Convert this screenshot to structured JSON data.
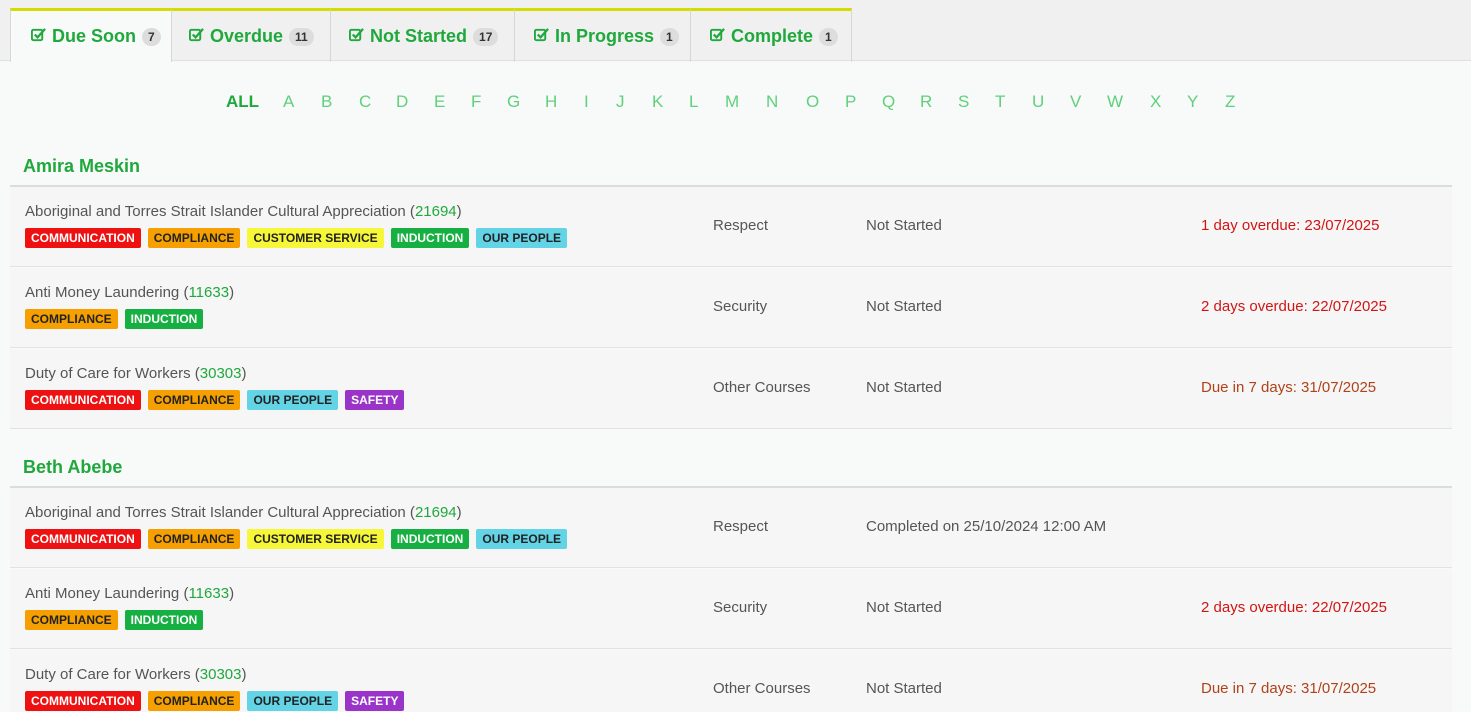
{
  "tabs": [
    {
      "label": "Due Soon",
      "count": "7"
    },
    {
      "label": "Overdue",
      "count": "11"
    },
    {
      "label": "Not Started",
      "count": "17"
    },
    {
      "label": "In Progress",
      "count": "1"
    },
    {
      "label": "Complete",
      "count": "1"
    }
  ],
  "alphabet": [
    "ALL",
    "A",
    "B",
    "C",
    "D",
    "E",
    "F",
    "G",
    "H",
    "I",
    "J",
    "K",
    "L",
    "M",
    "N",
    "O",
    "P",
    "Q",
    "R",
    "S",
    "T",
    "U",
    "V",
    "W",
    "X",
    "Y",
    "Z"
  ],
  "people": [
    {
      "name": "Amira Meskin",
      "courses": [
        {
          "title": "Aboriginal and Torres Strait Islander Cultural Appreciation",
          "code": "21694",
          "tags": [
            "COMMUNICATION",
            "COMPLIANCE",
            "CUSTOMER SERVICE",
            "INDUCTION",
            "OUR PEOPLE"
          ],
          "category": "Respect",
          "status": "Not Started",
          "due": "1 day overdue: 23/07/2025",
          "due_type": "overdue"
        },
        {
          "title": "Anti Money Laundering",
          "code": "11633",
          "tags": [
            "COMPLIANCE",
            "INDUCTION"
          ],
          "category": "Security",
          "status": "Not Started",
          "due": "2 days overdue: 22/07/2025",
          "due_type": "overdue"
        },
        {
          "title": "Duty of Care for Workers",
          "code": "30303",
          "tags": [
            "COMMUNICATION",
            "COMPLIANCE",
            "OUR PEOPLE",
            "SAFETY"
          ],
          "category": "Other Courses",
          "status": "Not Started",
          "due": "Due in 7 days: 31/07/2025",
          "due_type": "soon"
        }
      ]
    },
    {
      "name": "Beth Abebe",
      "courses": [
        {
          "title": "Aboriginal and Torres Strait Islander Cultural Appreciation",
          "code": "21694",
          "tags": [
            "COMMUNICATION",
            "COMPLIANCE",
            "CUSTOMER SERVICE",
            "INDUCTION",
            "OUR PEOPLE"
          ],
          "category": "Respect",
          "status": "Completed on 25/10/2024 12:00 AM",
          "due": "",
          "due_type": "none"
        },
        {
          "title": "Anti Money Laundering",
          "code": "11633",
          "tags": [
            "COMPLIANCE",
            "INDUCTION"
          ],
          "category": "Security",
          "status": "Not Started",
          "due": "2 days overdue: 22/07/2025",
          "due_type": "overdue"
        },
        {
          "title": "Duty of Care for Workers",
          "code": "30303",
          "tags": [
            "COMMUNICATION",
            "COMPLIANCE",
            "OUR PEOPLE",
            "SAFETY"
          ],
          "category": "Other Courses",
          "status": "Not Started",
          "due": "Due in 7 days: 31/07/2025",
          "due_type": "soon"
        }
      ]
    }
  ],
  "tag_colors": {
    "COMMUNICATION": "#ee1111",
    "COMPLIANCE": "#f5a000",
    "CUSTOMER SERVICE": "#f7f73a",
    "INDUCTION": "#15b041",
    "OUR PEOPLE": "#63d3e6",
    "SAFETY": "#9a34c8"
  },
  "colors": {
    "accent_green": "#1fa83c",
    "tab_top_border": "#d4dc00",
    "overdue": "#d11515",
    "due_soon": "#b0421a"
  },
  "icons": {
    "tab_icon": "checkbox-checked-icon"
  }
}
